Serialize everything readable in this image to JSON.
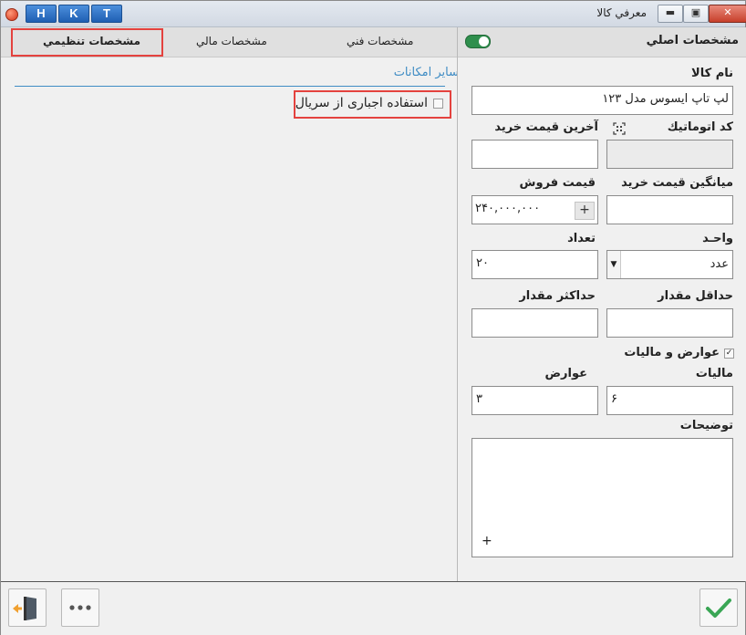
{
  "window": {
    "title": "معرفي كالا",
    "hkt": [
      "H",
      "K",
      "T"
    ],
    "controls": {
      "minimize": "▬",
      "restore": "▣",
      "close": "✕"
    }
  },
  "tabs": [
    {
      "label": "مشخصات فني"
    },
    {
      "label": "مشخصات مالي"
    },
    {
      "label": "مشخصات تنظيمي"
    }
  ],
  "right_panel": {
    "title": "مشخصات اصلي",
    "toggle_on": true,
    "fields": {
      "name": {
        "label": "نام كالا",
        "value": "لپ تاپ ايسوس مدل ۱۲۳"
      },
      "auto_code": {
        "label": "كد اتوماتيك",
        "value": ""
      },
      "last_purchase": {
        "label": "آخرين قيمت خريد",
        "value": ""
      },
      "avg_purchase": {
        "label": "ميانگين قيمت خريد",
        "value": ""
      },
      "sale_price": {
        "label": "قيمت فروش",
        "value": "۲۴۰,۰۰۰,۰۰۰"
      },
      "unit": {
        "label": "واحـد",
        "value": "عدد"
      },
      "quantity": {
        "label": "تعداد",
        "value": "۲۰"
      },
      "min_qty": {
        "label": "حداقل مقدار",
        "value": ""
      },
      "max_qty": {
        "label": "حداكثر مقدار",
        "value": ""
      },
      "taxes_check": {
        "label": "عوارض و ماليات",
        "checked": true
      },
      "tax": {
        "label": "ماليات",
        "value": "۶"
      },
      "duty": {
        "label": "عوارض",
        "value": "۳"
      },
      "notes": {
        "label": "توضيحات",
        "value": ""
      }
    }
  },
  "left_panel": {
    "section_title": "ساير امكانات",
    "serial_option": {
      "label": "استفاده اجباری از سريال",
      "checked": false
    }
  },
  "plus_glyph": "+",
  "colors": {
    "accent": "#3f8cc4",
    "highlight": "#e4423e",
    "ok_green": "#3aa655",
    "exit_orange": "#f0a030"
  }
}
